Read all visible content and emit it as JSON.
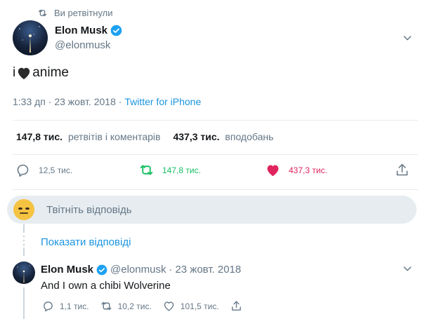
{
  "retweet_context": {
    "text": "Ви ретвітнули",
    "icon": "retweet-icon"
  },
  "tweet": {
    "author_name": "Elon Musk",
    "author_handle": "@elonmusk",
    "text_before": "i",
    "text_after": "anime",
    "timestamp": "1:33 дп · 23 жовт. 2018",
    "source": "Twitter for iPhone",
    "stats": {
      "retweets_value": "147,8 тис.",
      "retweets_label": "ретвітів і коментарів",
      "likes_value": "437,3 тис.",
      "likes_label": "вподобань"
    },
    "actions": {
      "reply_count": "12,5 тис.",
      "retweet_count": "147,8 тис.",
      "like_count": "437,3 тис."
    }
  },
  "reply_composer": {
    "placeholder": "Твітніть відповідь"
  },
  "show_replies_label": "Показати відповіді",
  "reply": {
    "author_name": "Elon Musk",
    "author_handle": "@elonmusk",
    "date": "23 жовт. 2018",
    "text": "And I own a chibi Wolverine",
    "actions": {
      "reply_count": "1,1 тис.",
      "retweet_count": "10,2 тис.",
      "like_count": "101,5 тис."
    }
  },
  "colors": {
    "accent": "#1b95e0",
    "retweet_green": "#17bf63",
    "like_red": "#e0245e",
    "secondary_text": "#657786"
  }
}
